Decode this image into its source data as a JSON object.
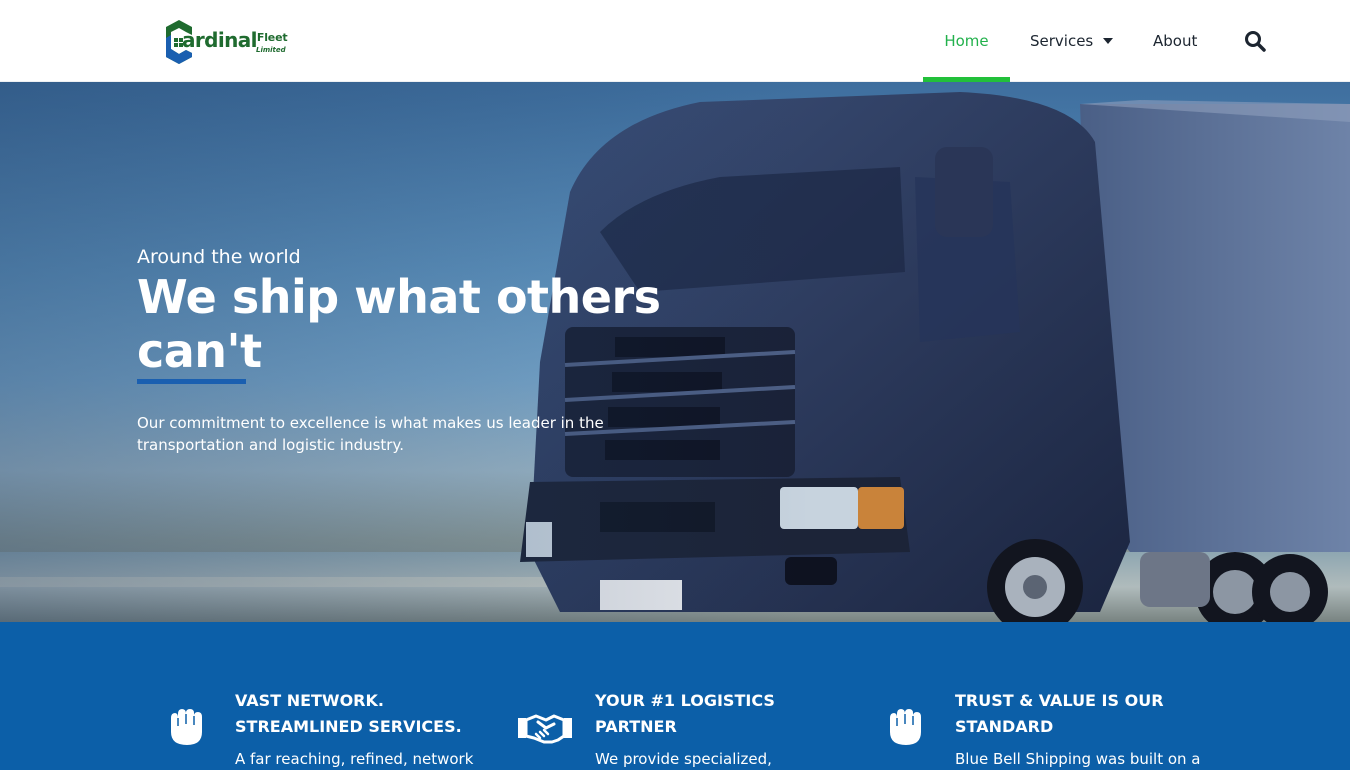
{
  "brand": {
    "name_main": "ardinal",
    "name_fleet": "Fleet",
    "name_sub": "Limited",
    "colors": {
      "primary_green": "#1f6b2f",
      "primary_blue": "#0c5fa8",
      "accent_green": "#22c03a"
    }
  },
  "nav": {
    "items": [
      {
        "label": "Home",
        "active": true
      },
      {
        "label": "Services",
        "has_dropdown": true
      },
      {
        "label": "About"
      }
    ],
    "search_icon": "search-icon"
  },
  "hero": {
    "kicker": "Around the world",
    "title": "We ship what others can't",
    "description": "Our commitment to excellence is what makes us leader in the transportation and logistic industry."
  },
  "features": [
    {
      "icon": "hand-icon",
      "title_line1": "VAST NETWORK.",
      "title_line2": "STREAMLINED SERVICES.",
      "description": "A far reaching, refined, network"
    },
    {
      "icon": "handshake-icon",
      "title_line1": "YOUR #1 LOGISTICS",
      "title_line2": "PARTNER",
      "description": "We provide specialized,"
    },
    {
      "icon": "hand-icon",
      "title_line1": "TRUST & VALUE IS OUR",
      "title_line2": "STANDARD",
      "description": "Blue Bell Shipping was built on a"
    }
  ]
}
